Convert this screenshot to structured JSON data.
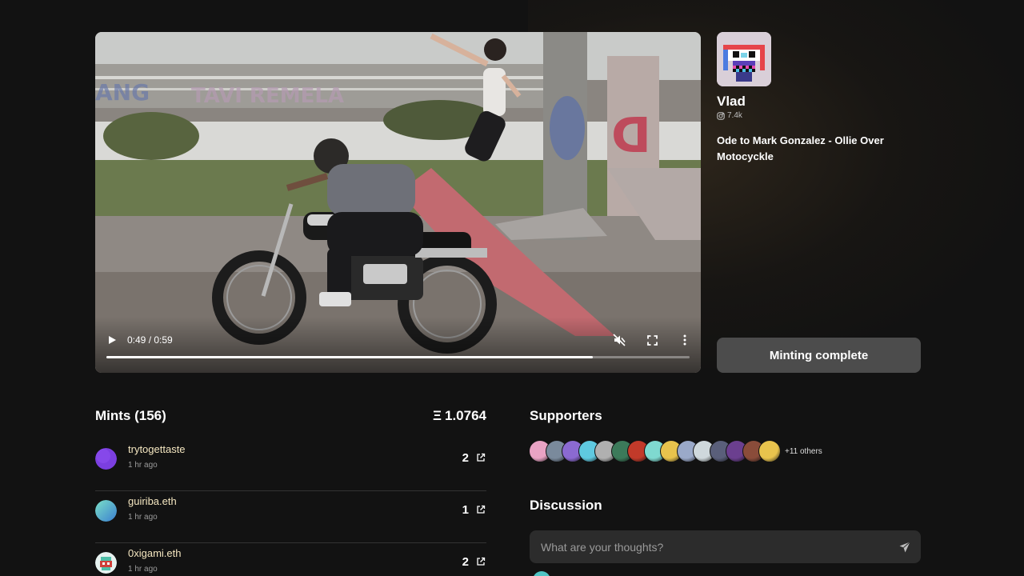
{
  "video": {
    "time_label": "0:49 / 0:59",
    "progress": 0.834
  },
  "artist": {
    "name": "Vlad",
    "followers": "7.4k",
    "work_title": "Ode to Mark Gonzalez - Ollie Over Motocyckle"
  },
  "mint_button": {
    "label": "Minting complete"
  },
  "mints": {
    "title": "Mints (156)",
    "total": "1.0764",
    "currency_symbol": "Ξ",
    "items": [
      {
        "user": "trytogettaste",
        "time": "1 hr ago",
        "count": "2",
        "avatar_color": "#7b3fe0"
      },
      {
        "user": "guiriba.eth",
        "time": "1 hr ago",
        "count": "1",
        "avatar_color": "#5ec7c0"
      },
      {
        "user": "0xigami.eth",
        "time": "1 hr ago",
        "count": "2",
        "avatar_color": "#e6f2f0"
      }
    ]
  },
  "supporters": {
    "title": "Supporters",
    "others_label": "+11 others",
    "avatar_colors": [
      "#e9a3c4",
      "#7a8a9c",
      "#8b6ad1",
      "#5fc9e0",
      "#b0b0b0",
      "#3c7a5a",
      "#c23a2a",
      "#7fd9d0",
      "#e8c34d",
      "#9aa9c9",
      "#cfd8dc",
      "#5a5f7a",
      "#6b3f8f",
      "#8a4c3a",
      "#e8c34d"
    ]
  },
  "discussion": {
    "title": "Discussion",
    "placeholder": "What are your thoughts?"
  },
  "colors": {
    "background": "#121212",
    "button_bg": "#4c4c4c",
    "input_bg": "#2c2c2c",
    "username": "#f4e6c0"
  },
  "icons": {
    "play": "play-icon",
    "mute": "muted-speaker-icon",
    "fullscreen": "fullscreen-icon",
    "more": "kebab-menu-icon",
    "followers": "instagram-icon",
    "external": "external-link-icon",
    "send": "send-icon"
  }
}
